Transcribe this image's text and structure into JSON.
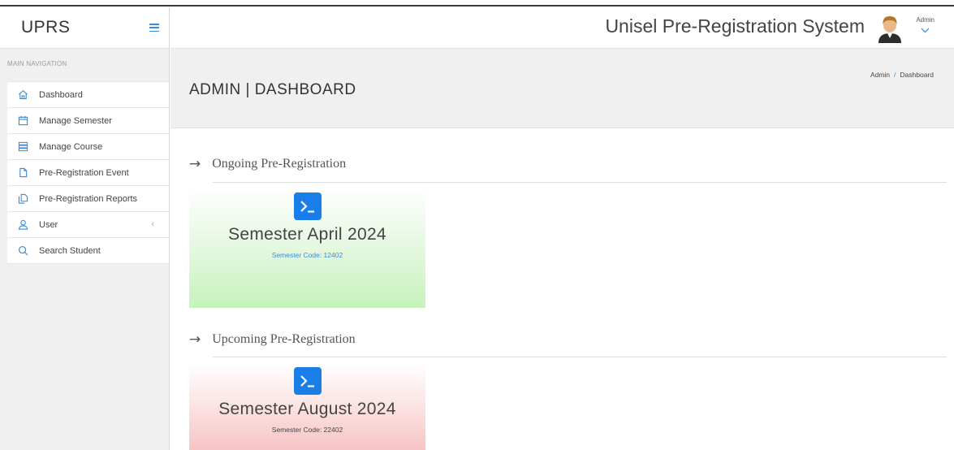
{
  "sidebar": {
    "brand": "UPRS",
    "nav_header": "MAIN NAVIGATION",
    "items": [
      {
        "label": "Dashboard",
        "icon": "home-icon"
      },
      {
        "label": "Manage Semester",
        "icon": "calendar-icon"
      },
      {
        "label": "Manage Course",
        "icon": "list-icon"
      },
      {
        "label": "Pre-Registration Event",
        "icon": "file-icon"
      },
      {
        "label": "Pre-Registration Reports",
        "icon": "files-icon"
      },
      {
        "label": "User",
        "icon": "user-icon"
      },
      {
        "label": "Search Student",
        "icon": "search-icon"
      }
    ]
  },
  "header": {
    "app_title": "Unisel Pre-Registration System",
    "user_label": "Admin"
  },
  "title_bar": {
    "page_title": "ADMIN | DASHBOARD",
    "breadcrumb_root": "Admin",
    "breadcrumb_current": "Dashboard"
  },
  "ongoing": {
    "heading": "Ongoing Pre-Registration",
    "card": {
      "name": "Semester April 2024",
      "code": "Semester Code: 12402"
    }
  },
  "upcoming": {
    "heading": "Upcoming Pre-Registration",
    "card": {
      "name": "Semester August 2024",
      "code": "Semester Code: 22402"
    }
  },
  "colors": {
    "accent": "#3d8bd6",
    "card_icon": "#1a7ee8",
    "ongoing_card": "#c6f3bb",
    "upcoming_card": "#f7c4c4"
  }
}
